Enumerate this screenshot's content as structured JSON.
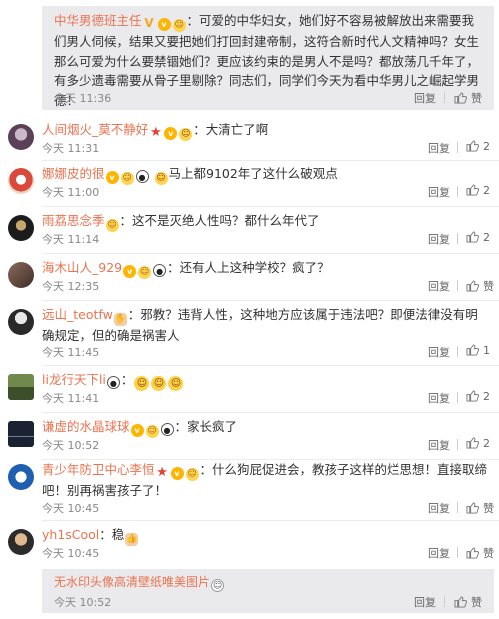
{
  "top_reply": {
    "user": "中华男德班主任",
    "text": "：可爱的中华妇女，她们好不容易被解放出来需要我们男人伺候，结果又要把她们打回封建帝制，这符合新时代人文精神吗？女生那么可爱为什么要禁锢她们？更应该约束的是男人不是吗？都放荡几千年了，有多少遗毒需要从骨子里剔除？同志们，同学们今天为看中华男儿之崛起学男德！",
    "time": "今天 11:36",
    "reply": "回复",
    "like": "赞"
  },
  "comments": [
    {
      "user": "人间烟火_莫不静好",
      "text": "：大清亡了啊",
      "time": "今天 11:31",
      "reply": "回复",
      "likes": "2"
    },
    {
      "user": "娜娜皮的很",
      "text": "马上都9102年了这什么破观点",
      "time": "今天 11:00",
      "reply": "回复",
      "likes": "2"
    },
    {
      "user": "雨荔思念季",
      "text": "：这不是灭绝人性吗？都什么年代了",
      "time": "今天 11:14",
      "reply": "回复",
      "likes": "2"
    },
    {
      "user": "海木山人_929",
      "text": "：还有人上这种学校？疯了？",
      "time": "今天 12:35",
      "reply": "回复",
      "likes": "赞"
    },
    {
      "user": "远山_teotfw",
      "text": "：邪教？违背人性，这种地方应该属于违法吧？即便法律没有明确规定，但的确是祸害人",
      "time": "今天 11:45",
      "reply": "回复",
      "likes": "1"
    },
    {
      "user": "li龙行天下li",
      "text": "：",
      "time": "今天 11:41",
      "reply": "回复",
      "likes": "2"
    },
    {
      "user": "谦虚的水晶球球",
      "text": "：家长疯了",
      "time": "今天 10:52",
      "reply": "回复",
      "likes": "2"
    },
    {
      "user": "青少年防卫中心李恒",
      "text": "：什么狗屁促进会，教孩子这样的烂思想！直接取缔吧！别再祸害孩子了！",
      "time": "今天 10:45",
      "reply": "回复",
      "likes": "赞"
    },
    {
      "user": "yh1sCool",
      "text": "：稳",
      "time": "今天 10:45",
      "reply": "回复",
      "likes": "赞"
    }
  ],
  "bottom_box": {
    "text": "无水印头像高清壁纸唯美图片",
    "time": "今天 10:52",
    "reply": "回复",
    "like": "赞"
  },
  "colors": {
    "username": "#eb7350",
    "box_bg": "#eaeaec"
  }
}
